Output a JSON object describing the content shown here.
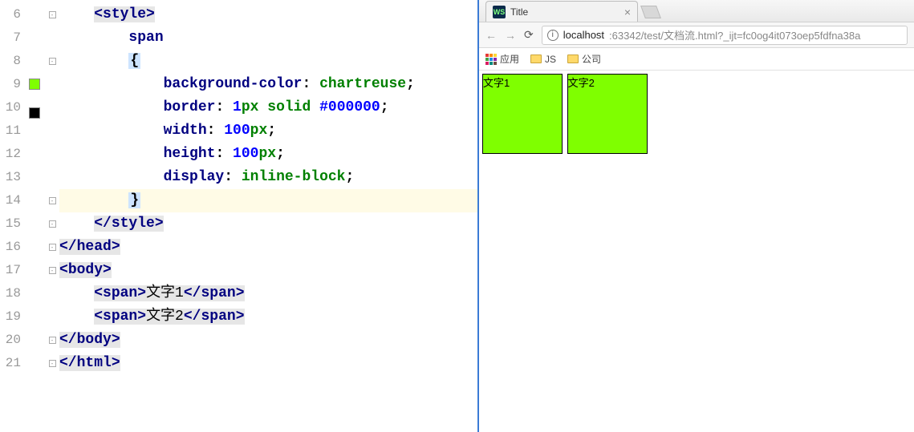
{
  "editor": {
    "line_start": 6,
    "line_end": 21,
    "code_lines": {
      "6": {
        "indent": "    ",
        "parts": [
          {
            "t": "tag_open",
            "name": "style"
          }
        ]
      },
      "7": {
        "indent": "        ",
        "parts": [
          {
            "t": "sel",
            "v": "span"
          }
        ]
      },
      "8": {
        "indent": "        ",
        "parts": [
          {
            "t": "brace",
            "v": "{"
          }
        ]
      },
      "9": {
        "indent": "            ",
        "parts": [
          {
            "t": "decl",
            "prop": "background-color",
            "val": "chartreuse",
            "kind": "ident"
          }
        ]
      },
      "10": {
        "indent": "            ",
        "parts": [
          {
            "t": "decl",
            "prop": "border",
            "val": "1px solid #000000",
            "kind": "mixed"
          }
        ]
      },
      "11": {
        "indent": "            ",
        "parts": [
          {
            "t": "decl",
            "prop": "width",
            "val": "100px",
            "kind": "num"
          }
        ]
      },
      "12": {
        "indent": "            ",
        "parts": [
          {
            "t": "decl",
            "prop": "height",
            "val": "100px",
            "kind": "num"
          }
        ]
      },
      "13": {
        "indent": "            ",
        "parts": [
          {
            "t": "decl",
            "prop": "display",
            "val": "inline-block",
            "kind": "ident"
          }
        ]
      },
      "14": {
        "indent": "        ",
        "parts": [
          {
            "t": "brace",
            "v": "}"
          }
        ],
        "highlight": true
      },
      "15": {
        "indent": "    ",
        "parts": [
          {
            "t": "tag_close",
            "name": "style"
          }
        ]
      },
      "16": {
        "indent": "",
        "parts": [
          {
            "t": "tag_close",
            "name": "head"
          }
        ]
      },
      "17": {
        "indent": "",
        "parts": [
          {
            "t": "tag_open",
            "name": "body"
          }
        ]
      },
      "18": {
        "indent": "    ",
        "parts": [
          {
            "t": "span_text",
            "text": "文字1"
          }
        ]
      },
      "19": {
        "indent": "    ",
        "parts": [
          {
            "t": "span_text",
            "text": "文字2"
          }
        ]
      },
      "20": {
        "indent": "",
        "parts": [
          {
            "t": "tag_close",
            "name": "body"
          }
        ]
      },
      "21": {
        "indent": "",
        "parts": [
          {
            "t": "tag_close",
            "name": "html"
          }
        ]
      }
    },
    "swatches": {
      "9": "chartreuse",
      "10": "black"
    },
    "fold_handles": [
      6,
      8,
      14,
      15,
      16,
      17,
      20,
      21
    ]
  },
  "browser": {
    "tab": {
      "favicon_text": "WS",
      "title": "Title",
      "close": "×"
    },
    "nav": {
      "back": "←",
      "forward": "→",
      "reload": "⟳"
    },
    "omnibox": {
      "info": "i",
      "host": "localhost",
      "port_path": ":63342/test/文档流.html?_ijt=fc0og4it073oep5fdfna38a"
    },
    "bookmarks": {
      "apps_label": "应用",
      "items": [
        "JS",
        "公司"
      ]
    },
    "page": {
      "spans": [
        "文字1",
        "文字2"
      ]
    }
  }
}
